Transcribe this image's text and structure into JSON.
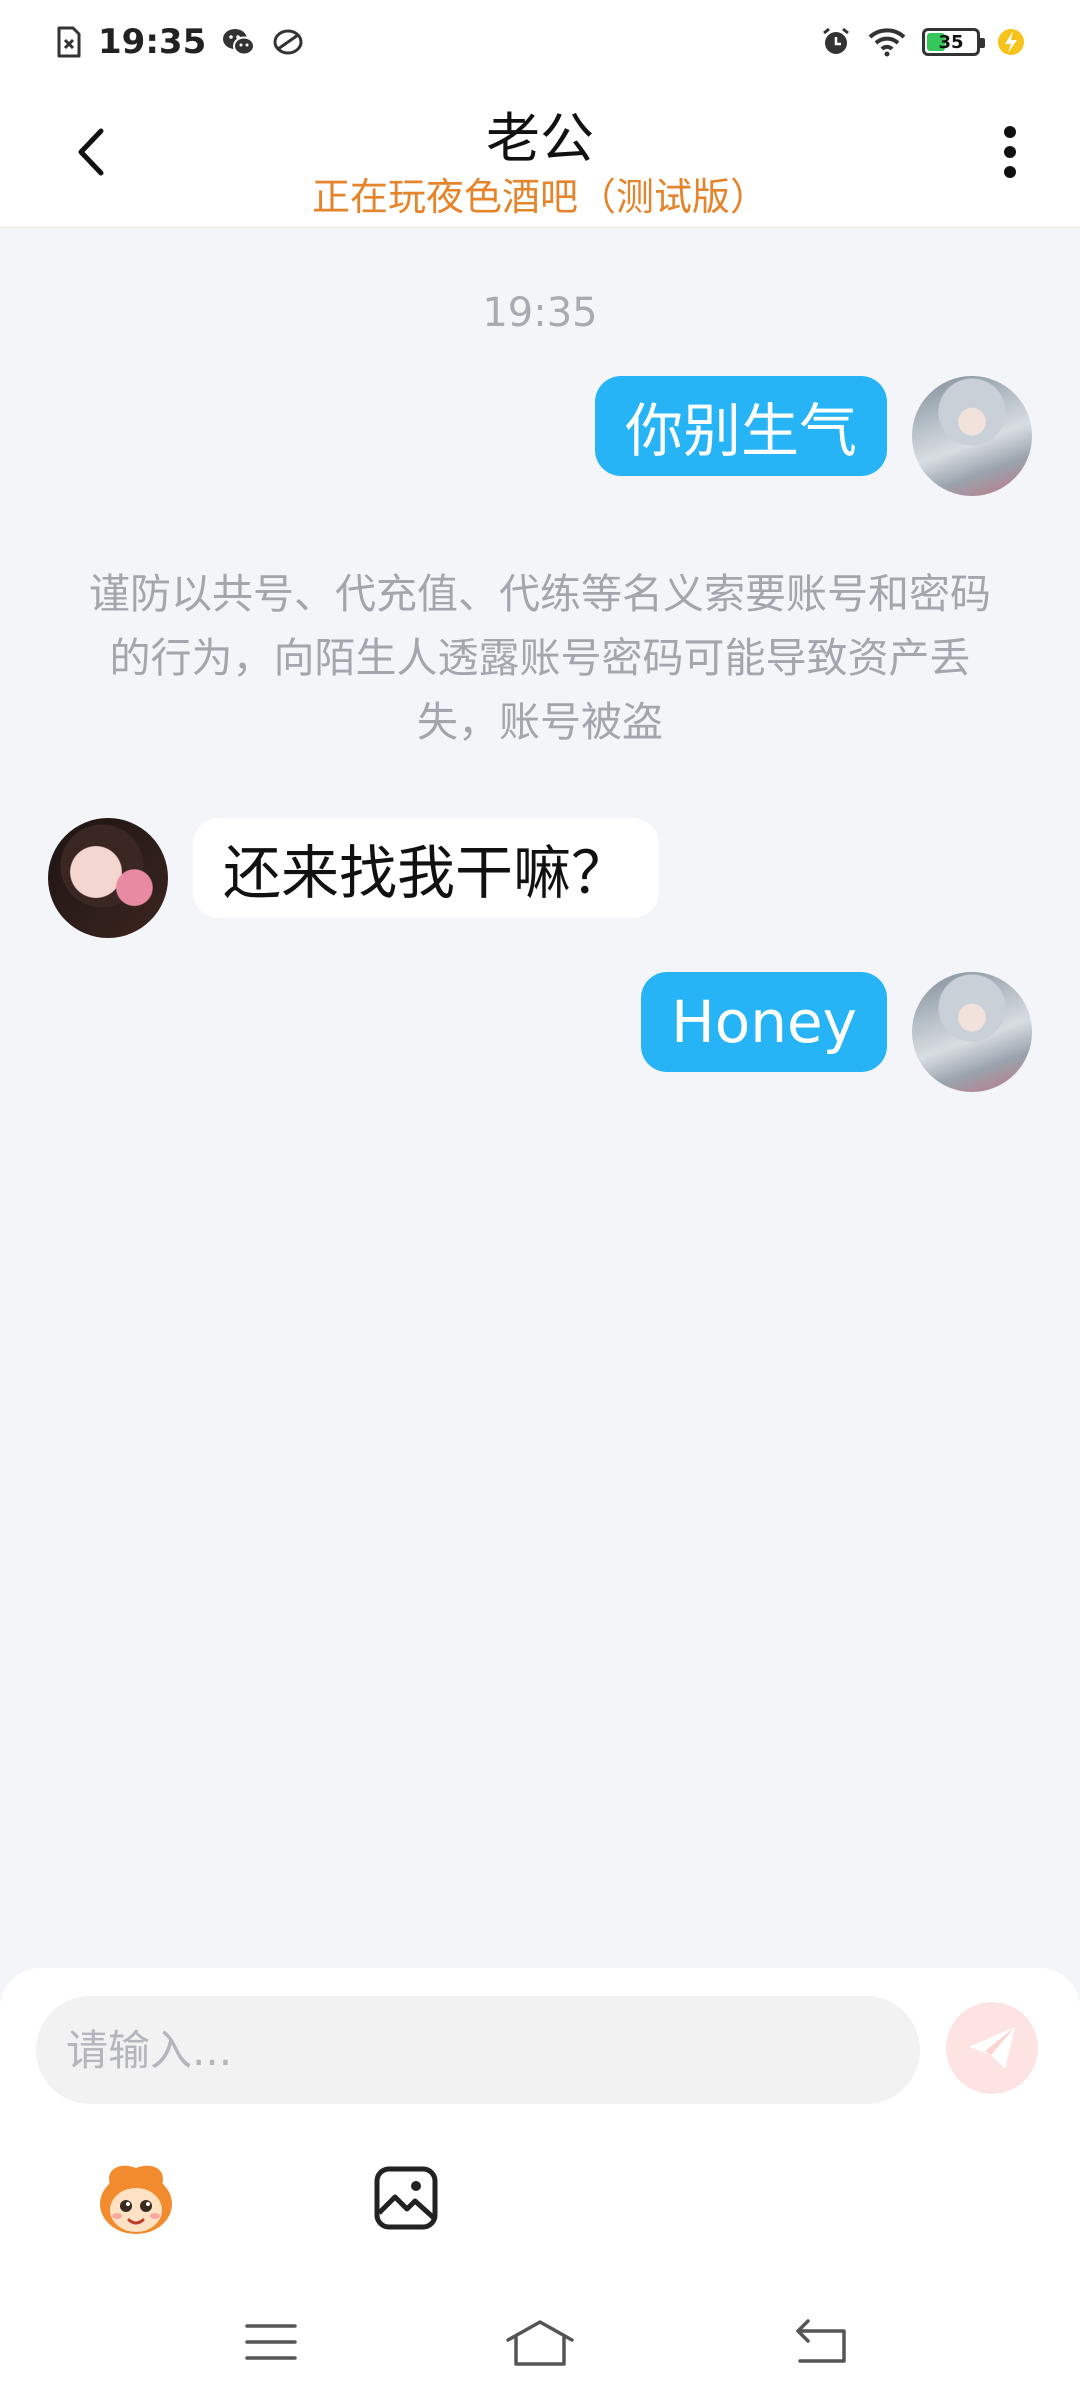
{
  "status_bar": {
    "time": "19:35",
    "battery": "35",
    "icons": [
      "sim-missing-icon",
      "wechat-icon",
      "app-icon",
      "alarm-icon",
      "wifi-icon",
      "battery-icon",
      "charging-icon"
    ]
  },
  "header": {
    "title": "老公",
    "subtitle": "正在玩夜色酒吧（测试版）",
    "back_icon": "chevron-left-icon",
    "more_icon": "more-vertical-icon"
  },
  "chat": {
    "timestamp": "19:35",
    "messages": [
      {
        "sender": "me",
        "text": "你别生气"
      },
      {
        "sender": "system",
        "text": "谨防以共号、代充值、代练等名义索要账号和密码的行为，向陌生人透露账号密码可能导致资产丢失，账号被盗"
      },
      {
        "sender": "her",
        "text": "还来找我干嘛？"
      },
      {
        "sender": "me",
        "text": "Honey"
      }
    ]
  },
  "composer": {
    "placeholder": "请输入...",
    "value": "",
    "send_icon": "send-icon",
    "tools": [
      "emoji-mascot-icon",
      "image-icon"
    ]
  },
  "nav_bar": {
    "icons": [
      "menu-icon",
      "home-icon",
      "back-icon"
    ]
  },
  "colors": {
    "accent_orange": "#e5842b",
    "bubble_me": "#27b4f6",
    "send_button_bg": "#fde4e3"
  }
}
